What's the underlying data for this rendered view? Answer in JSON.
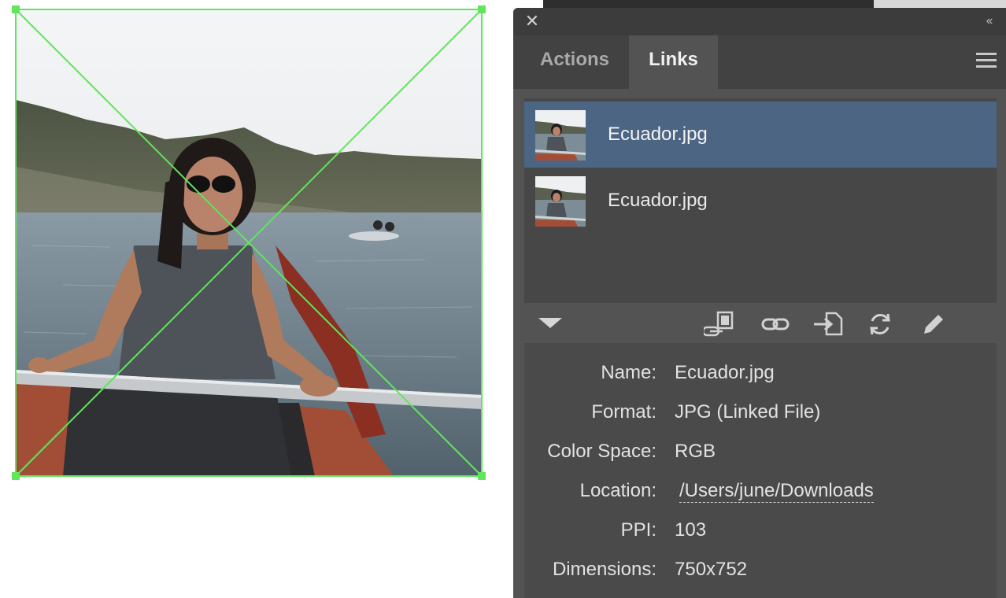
{
  "panel": {
    "close_glyph": "✕",
    "collapse_glyph": "‹‹",
    "tabs": [
      {
        "label": "Actions",
        "active": false
      },
      {
        "label": "Links",
        "active": true
      }
    ],
    "menu_icon": "hamburger-menu-icon"
  },
  "links": [
    {
      "name": "Ecuador.jpg",
      "selected": true
    },
    {
      "name": "Ecuador.jpg",
      "selected": false
    }
  ],
  "toolbar": {
    "icons": [
      "relink-from-libraries-icon",
      "relink-icon",
      "go-to-link-icon",
      "update-link-icon",
      "edit-original-icon"
    ]
  },
  "info": {
    "name_label": "Name:",
    "name_value": "Ecuador.jpg",
    "format_label": "Format:",
    "format_value": "JPG (Linked File)",
    "colorspace_label": "Color Space:",
    "colorspace_value": "RGB",
    "location_label": "Location:",
    "location_value": "/Users/june/Downloads",
    "ppi_label": "PPI:",
    "ppi_value": "103",
    "dimensions_label": "Dimensions:",
    "dimensions_value": "750x752"
  },
  "colors": {
    "panel_bg": "#535353",
    "selection": "#4b6583",
    "bounding_box": "#5fe65a"
  }
}
